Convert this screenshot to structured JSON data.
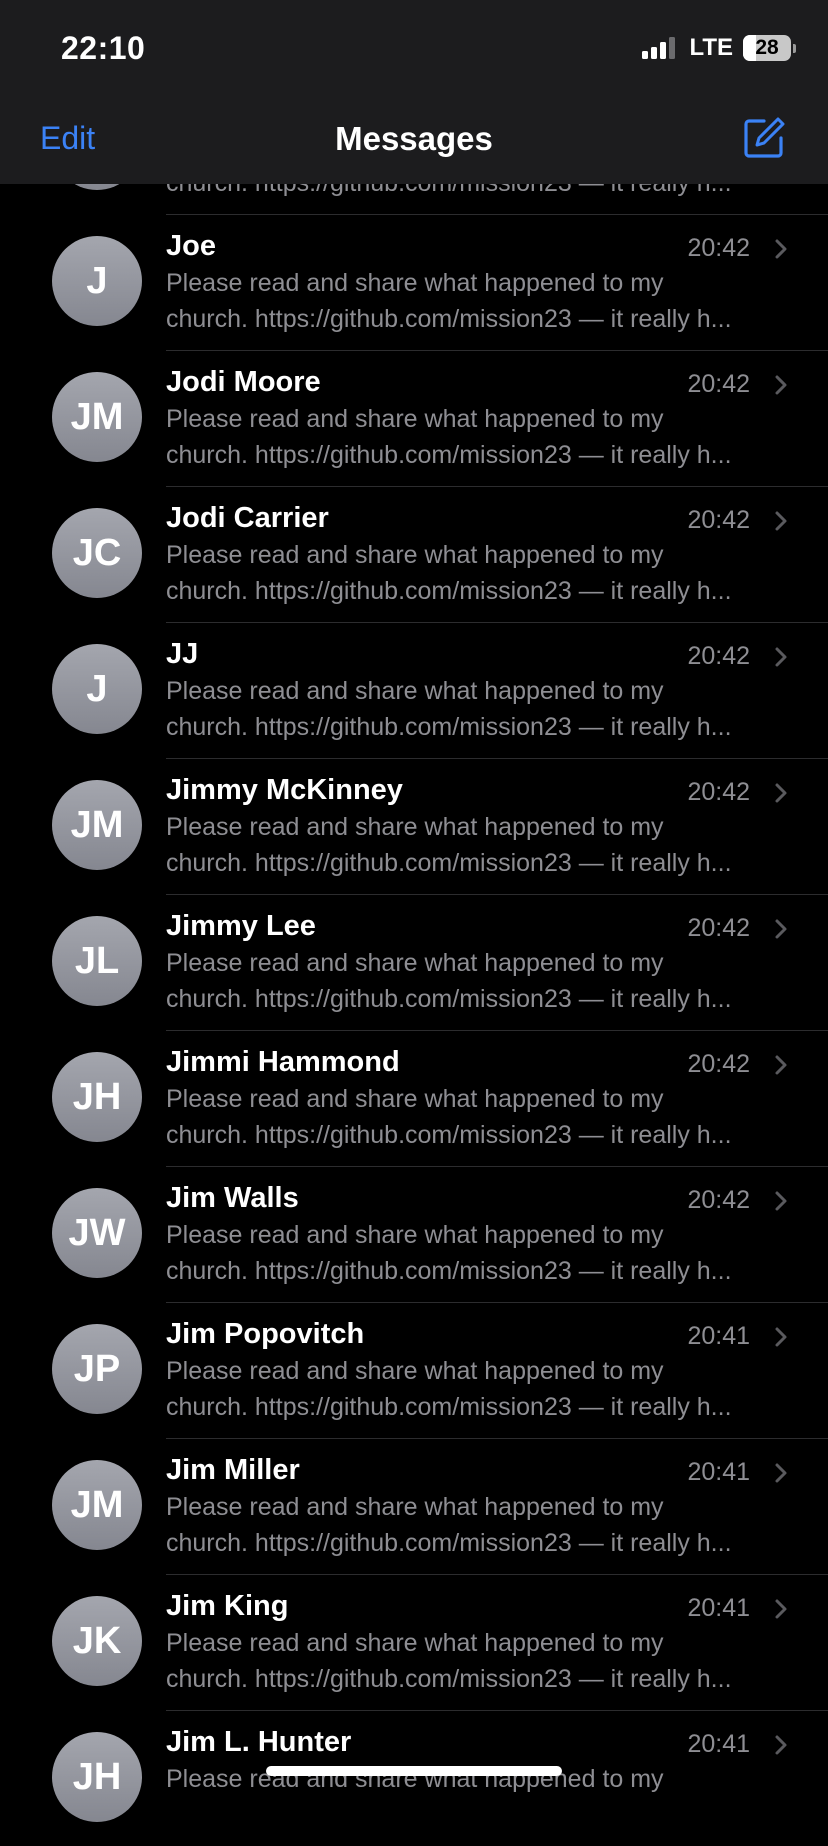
{
  "status_bar": {
    "time": "22:10",
    "network": "LTE",
    "battery": "28",
    "battery_level": 0.28
  },
  "nav": {
    "edit_label": "Edit",
    "title": "Messages",
    "compose_icon": "compose-icon",
    "accent": "#3b82f6"
  },
  "partial_top": {
    "line2": "church. https://github.com/mission23 — it really h..."
  },
  "conversations": [
    {
      "initials": "J",
      "name": "Joe",
      "time": "20:42",
      "line1": "Please read and share what happened to my",
      "line2": "church. https://github.com/mission23 — it really h..."
    },
    {
      "initials": "JM",
      "name": "Jodi Moore",
      "time": "20:42",
      "line1": "Please read and share what happened to my",
      "line2": "church. https://github.com/mission23 — it really h..."
    },
    {
      "initials": "JC",
      "name": "Jodi Carrier",
      "time": "20:42",
      "line1": "Please read and share what happened to my",
      "line2": "church. https://github.com/mission23 — it really h..."
    },
    {
      "initials": "J",
      "name": "JJ",
      "time": "20:42",
      "line1": "Please read and share what happened to my",
      "line2": "church. https://github.com/mission23 — it really h..."
    },
    {
      "initials": "JM",
      "name": "Jimmy McKinney",
      "time": "20:42",
      "line1": "Please read and share what happened to my",
      "line2": "church. https://github.com/mission23 — it really h..."
    },
    {
      "initials": "JL",
      "name": "Jimmy Lee",
      "time": "20:42",
      "line1": "Please read and share what happened to my",
      "line2": "church. https://github.com/mission23 — it really h..."
    },
    {
      "initials": "JH",
      "name": "Jimmi Hammond",
      "time": "20:42",
      "line1": "Please read and share what happened to my",
      "line2": "church. https://github.com/mission23 — it really h..."
    },
    {
      "initials": "JW",
      "name": "Jim Walls",
      "time": "20:42",
      "line1": "Please read and share what happened to my",
      "line2": "church. https://github.com/mission23 — it really h..."
    },
    {
      "initials": "JP",
      "name": "Jim Popovitch",
      "time": "20:41",
      "line1": "Please read and share what happened to my",
      "line2": "church. https://github.com/mission23 — it really h..."
    },
    {
      "initials": "JM",
      "name": "Jim Miller",
      "time": "20:41",
      "line1": "Please read and share what happened to my",
      "line2": "church. https://github.com/mission23 — it really h..."
    },
    {
      "initials": "JK",
      "name": "Jim King",
      "time": "20:41",
      "line1": "Please read and share what happened to my",
      "line2": "church. https://github.com/mission23 — it really h..."
    },
    {
      "initials": "JH",
      "name": "Jim L. Hunter",
      "time": "20:41",
      "line1": "Please read and share what happened to my",
      "line2": ""
    }
  ]
}
